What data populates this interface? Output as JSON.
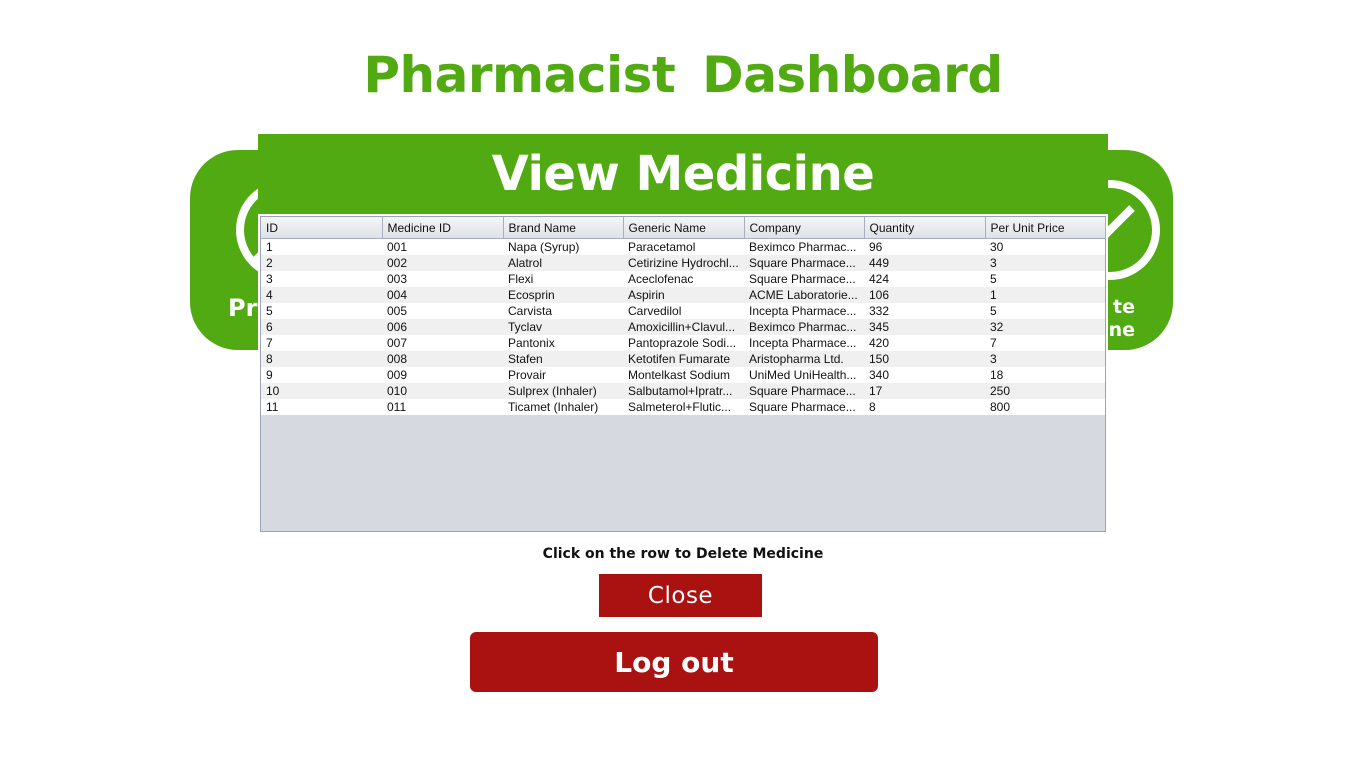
{
  "page_title": "Pharmacist  Dashboard",
  "tiles": {
    "left_label": "Pr",
    "right_label_line1": "te",
    "right_label_line2": "ine"
  },
  "modal": {
    "title": "View Medicine"
  },
  "table": {
    "columns": [
      "ID",
      "Medicine ID",
      "Brand Name",
      "Generic Name",
      "Company",
      "Quantity",
      "Per Unit Price"
    ],
    "rows": [
      [
        "1",
        "001",
        "Napa (Syrup)",
        "Paracetamol",
        "Beximco Pharmac...",
        "96",
        "30"
      ],
      [
        "2",
        "002",
        "Alatrol",
        "Cetirizine Hydrochl...",
        "Square Pharmace...",
        "449",
        "3"
      ],
      [
        "3",
        "003",
        "Flexi",
        "Aceclofenac",
        "Square Pharmace...",
        "424",
        "5"
      ],
      [
        "4",
        "004",
        "Ecosprin",
        "Aspirin",
        "ACME Laboratorie...",
        "106",
        "1"
      ],
      [
        "5",
        "005",
        "Carvista",
        "Carvedilol",
        "Incepta Pharmace...",
        "332",
        "5"
      ],
      [
        "6",
        "006",
        "Tyclav",
        "Amoxicillin+Clavul...",
        "Beximco Pharmac...",
        "345",
        "32"
      ],
      [
        "7",
        "007",
        "Pantonix",
        "Pantoprazole Sodi...",
        "Incepta Pharmace...",
        "420",
        "7"
      ],
      [
        "8",
        "008",
        "Stafen",
        "Ketotifen Fumarate",
        "Aristopharma Ltd.",
        "150",
        "3"
      ],
      [
        "9",
        "009",
        "Provair",
        "Montelkast Sodium",
        "UniMed UniHealth...",
        "340",
        "18"
      ],
      [
        "10",
        "010",
        "Sulprex (Inhaler)",
        "Salbutamol+Ipratr...",
        "Square Pharmace...",
        "17",
        "250"
      ],
      [
        "11",
        "011",
        "Ticamet (Inhaler)",
        "Salmeterol+Flutic...",
        "Square Pharmace...",
        "8",
        "800"
      ]
    ]
  },
  "hint": "Click on the row to Delete Medicine",
  "close_label": "Close",
  "logout_label": "Log out",
  "colors": {
    "brand_green": "#52aa12",
    "danger_red": "#aa1111"
  }
}
